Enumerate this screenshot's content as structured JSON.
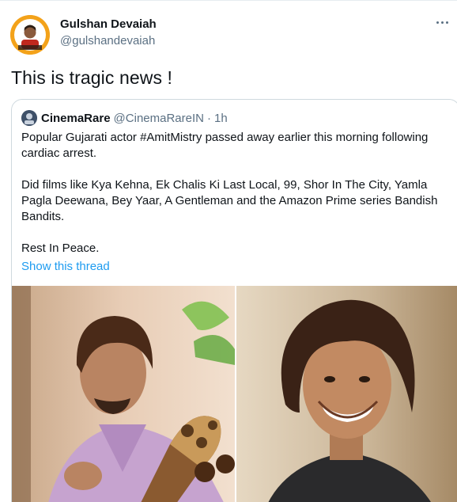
{
  "author": {
    "name": "Gulshan Devaiah",
    "handle": "@gulshandevaiah",
    "avatar_icon": "profile-avatar"
  },
  "more_icon": "more-horizontal-icon",
  "tweet": {
    "text": "This is tragic news !"
  },
  "quoted_tweet": {
    "name": "CinemaRare",
    "handle": "@CinemaRareIN",
    "separator": "·",
    "time": "1h",
    "paragraphs": [
      "Popular Gujarati actor #AmitMistry passed away earlier this morning following cardiac arrest.",
      "Did films like Kya Kehna, Ek Chalis Ki Last Local, 99, Shor In The City, Yamla Pagla Deewana, Bey Yaar, A Gentleman and the Amazon Prime series Bandish Bandits.",
      "Rest In Peace."
    ],
    "show_thread_label": "Show this thread",
    "media": [
      "photo-actor-playing-sarod",
      "photo-actor-smiling-portrait"
    ]
  },
  "colors": {
    "link": "#1d9bf0",
    "secondary_text": "#5b7083",
    "border": "#cfd9de"
  }
}
